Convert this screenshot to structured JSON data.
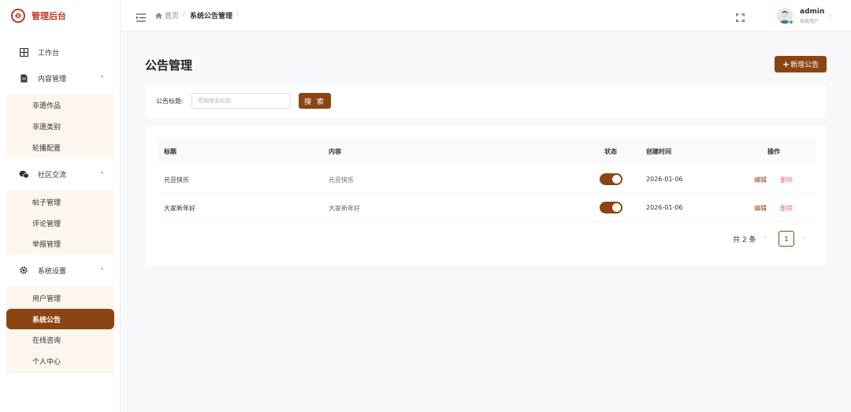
{
  "app": {
    "title": "管理后台"
  },
  "sidebar": {
    "dashboard": "工作台",
    "content_group": "内容管理",
    "content_items": [
      "非遗作品",
      "非遗类别",
      "轮播配置"
    ],
    "community_group": "社区交流",
    "community_items": [
      "帖子管理",
      "评论管理",
      "举报管理"
    ],
    "settings_group": "系统设置",
    "settings_items": [
      "用户管理",
      "系统公告",
      "在线咨询",
      "个人中心"
    ]
  },
  "header": {
    "breadcrumb_home": "首页",
    "breadcrumb_current": "系统公告管理",
    "user_name": "admin",
    "user_role": "系统用户"
  },
  "page": {
    "title": "公告管理",
    "add_button": "新增公告"
  },
  "search": {
    "label": "公告标题:",
    "placeholder": "模糊搜索标题",
    "button": "搜 索"
  },
  "table": {
    "columns": [
      "标题",
      "内容",
      "状态",
      "创建时间",
      "操作"
    ],
    "rows": [
      {
        "title": "元旦快乐",
        "content": "元旦快乐",
        "status_on": true,
        "created": "2026-01-06",
        "edit": "编辑",
        "delete": "删除"
      },
      {
        "title": "大家新年好",
        "content": "大家新年好",
        "status_on": true,
        "created": "2026-01-06",
        "edit": "编辑",
        "delete": "删除"
      }
    ]
  },
  "pagination": {
    "total": "共 2 条",
    "current": "1"
  },
  "colors": {
    "accent": "#8b4513",
    "brand": "#c0392b",
    "danger": "#e57373"
  },
  "icons": {
    "logo": "logo-icon",
    "dashboard": "grid-icon",
    "content": "document-icon",
    "community": "chat-icon",
    "settings": "gear-icon",
    "menu": "hamburger-icon",
    "home": "home-icon",
    "fullscreen": "fullscreen-icon"
  }
}
